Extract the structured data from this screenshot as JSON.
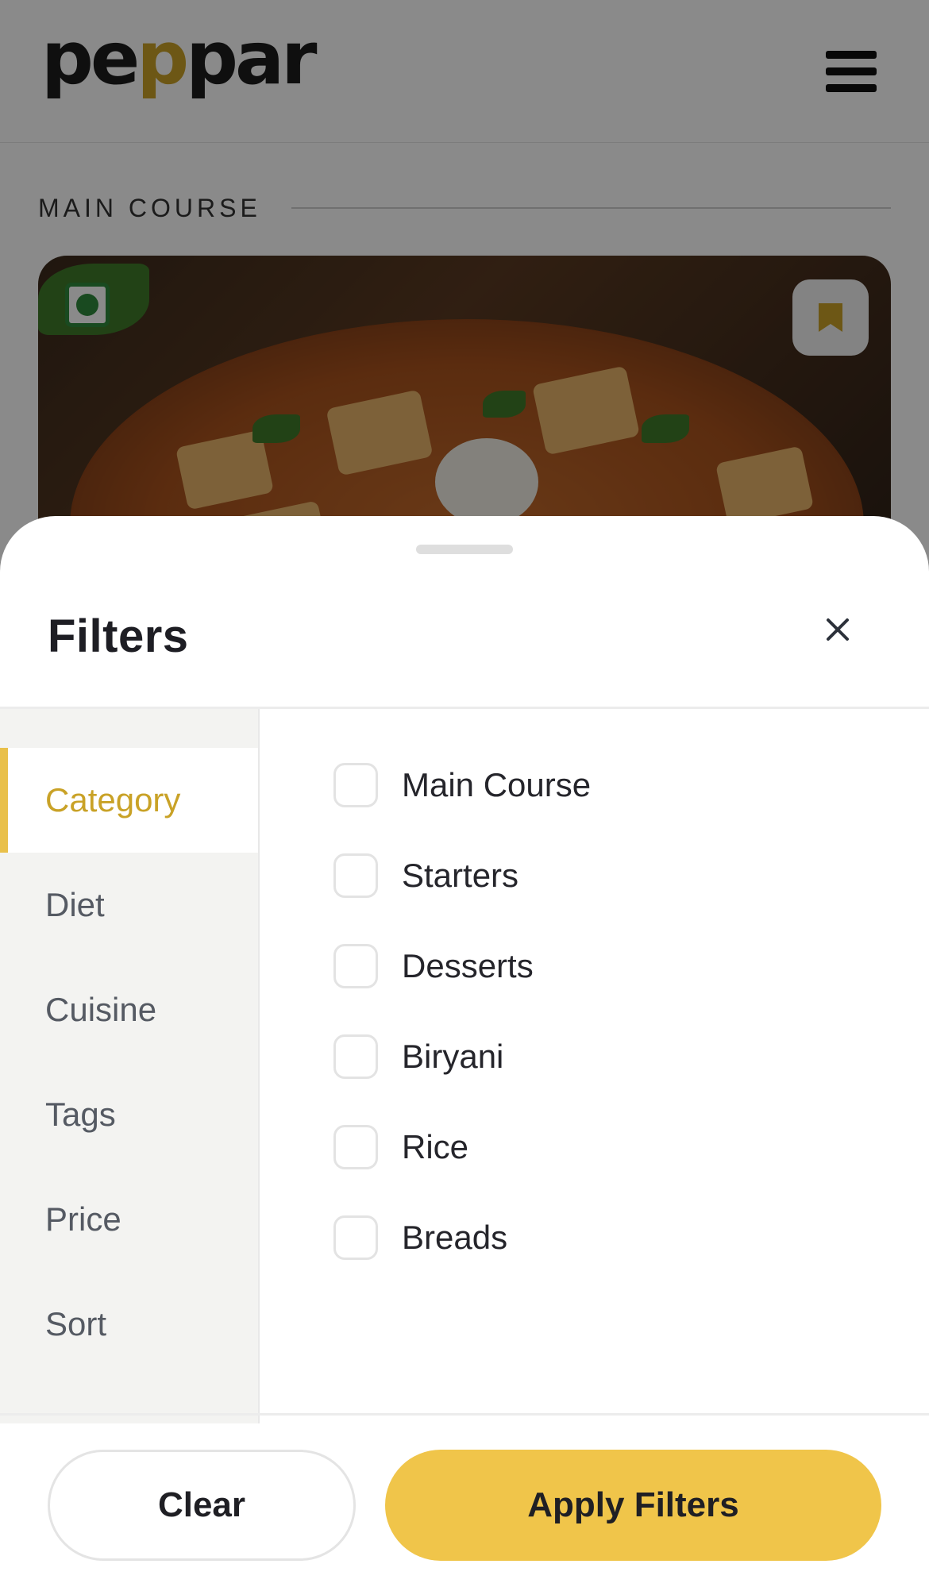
{
  "header": {
    "logo_text": "peppar",
    "menu_icon": "hamburger-menu-icon"
  },
  "main": {
    "section_title": "MAIN COURSE",
    "card": {
      "diet_icon": "veg-indicator-icon",
      "bookmark_icon": "bookmark-icon"
    }
  },
  "filters": {
    "title": "Filters",
    "close_icon": "close-icon",
    "tabs": [
      {
        "label": "Category",
        "active": true
      },
      {
        "label": "Diet"
      },
      {
        "label": "Cuisine"
      },
      {
        "label": "Tags"
      },
      {
        "label": "Price"
      },
      {
        "label": "Sort"
      }
    ],
    "options": [
      {
        "label": "Main Course",
        "checked": false
      },
      {
        "label": "Starters",
        "checked": false
      },
      {
        "label": "Desserts",
        "checked": false
      },
      {
        "label": "Biryani",
        "checked": false
      },
      {
        "label": "Rice",
        "checked": false
      },
      {
        "label": "Breads",
        "checked": false
      }
    ],
    "clear_label": "Clear",
    "apply_label": "Apply Filters"
  },
  "colors": {
    "accent": "#f0c54a",
    "accent_text": "#c9a227",
    "veg_green": "#2f8a3b"
  }
}
